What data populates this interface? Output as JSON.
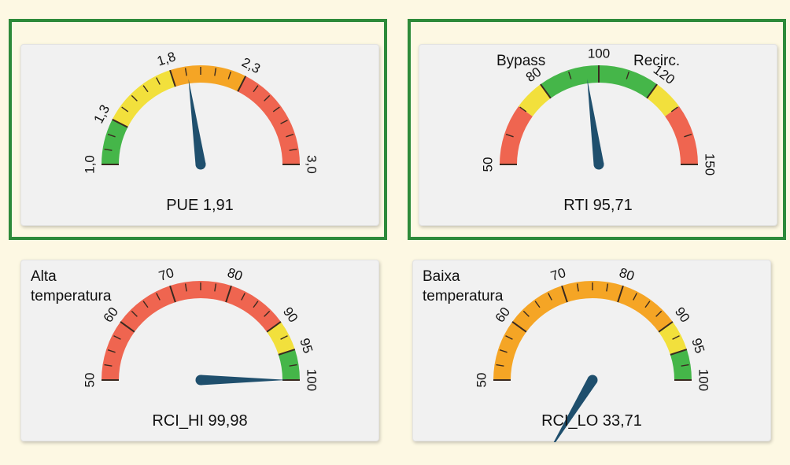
{
  "colors": {
    "green": "#45b649",
    "yellow": "#f2e03c",
    "orange": "#f5a525",
    "red": "#ef6550",
    "needle": "#1f4f6d",
    "frame": "#2d8a3a"
  },
  "chart_data": [
    {
      "type": "gauge",
      "label": "PUE 1,91",
      "value": 1.91,
      "min": 1.0,
      "max": 3.0,
      "bands": [
        {
          "from": 1.0,
          "to": 1.3,
          "color": "green"
        },
        {
          "from": 1.3,
          "to": 1.8,
          "color": "yellow"
        },
        {
          "from": 1.8,
          "to": 2.3,
          "color": "orange"
        },
        {
          "from": 2.3,
          "to": 3.0,
          "color": "red"
        }
      ],
      "tick_labels": [
        {
          "value": 1.0,
          "text": "1,0"
        },
        {
          "value": 1.3,
          "text": "1,3"
        },
        {
          "value": 1.8,
          "text": "1,8"
        },
        {
          "value": 2.3,
          "text": "2,3"
        },
        {
          "value": 3.0,
          "text": "3,0"
        }
      ],
      "minor_step": 0.1,
      "highlighted": true
    },
    {
      "type": "gauge",
      "label": "RTI 95,71",
      "value": 95.71,
      "min": 50,
      "max": 150,
      "corner_left": "Bypass",
      "corner_right": "Recirc.",
      "bands": [
        {
          "from": 50,
          "to": 70,
          "color": "red"
        },
        {
          "from": 70,
          "to": 80,
          "color": "yellow"
        },
        {
          "from": 80,
          "to": 120,
          "color": "green"
        },
        {
          "from": 120,
          "to": 130,
          "color": "yellow"
        },
        {
          "from": 130,
          "to": 150,
          "color": "red"
        }
      ],
      "tick_labels": [
        {
          "value": 50,
          "text": "50"
        },
        {
          "value": 80,
          "text": "80"
        },
        {
          "value": 100,
          "text": "100"
        },
        {
          "value": 120,
          "text": "120"
        },
        {
          "value": 150,
          "text": "150"
        }
      ],
      "minor_step": 10,
      "highlighted": true
    },
    {
      "type": "gauge",
      "label": "RCI_HI 99,98",
      "value": 99.98,
      "min": 50,
      "max": 100,
      "corner_left": "Alta\ntemperatura",
      "bands": [
        {
          "from": 50,
          "to": 90,
          "color": "red"
        },
        {
          "from": 90,
          "to": 95,
          "color": "yellow"
        },
        {
          "from": 95,
          "to": 100,
          "color": "green"
        }
      ],
      "tick_labels": [
        {
          "value": 50,
          "text": "50"
        },
        {
          "value": 60,
          "text": "60"
        },
        {
          "value": 70,
          "text": "70"
        },
        {
          "value": 80,
          "text": "80"
        },
        {
          "value": 90,
          "text": "90"
        },
        {
          "value": 95,
          "text": "95"
        },
        {
          "value": 100,
          "text": "100"
        }
      ],
      "minor_step": 2.5,
      "highlighted": false
    },
    {
      "type": "gauge",
      "label": "RCI_LO 33,71",
      "value": 33.71,
      "min": 50,
      "max": 100,
      "corner_left": "Baixa\ntemperatura",
      "bands": [
        {
          "from": 50,
          "to": 90,
          "color": "orange"
        },
        {
          "from": 90,
          "to": 95,
          "color": "yellow"
        },
        {
          "from": 95,
          "to": 100,
          "color": "green"
        }
      ],
      "tick_labels": [
        {
          "value": 50,
          "text": "50"
        },
        {
          "value": 60,
          "text": "60"
        },
        {
          "value": 70,
          "text": "70"
        },
        {
          "value": 80,
          "text": "80"
        },
        {
          "value": 90,
          "text": "90"
        },
        {
          "value": 95,
          "text": "95"
        },
        {
          "value": 100,
          "text": "100"
        }
      ],
      "minor_step": 2.5,
      "highlighted": false
    }
  ]
}
